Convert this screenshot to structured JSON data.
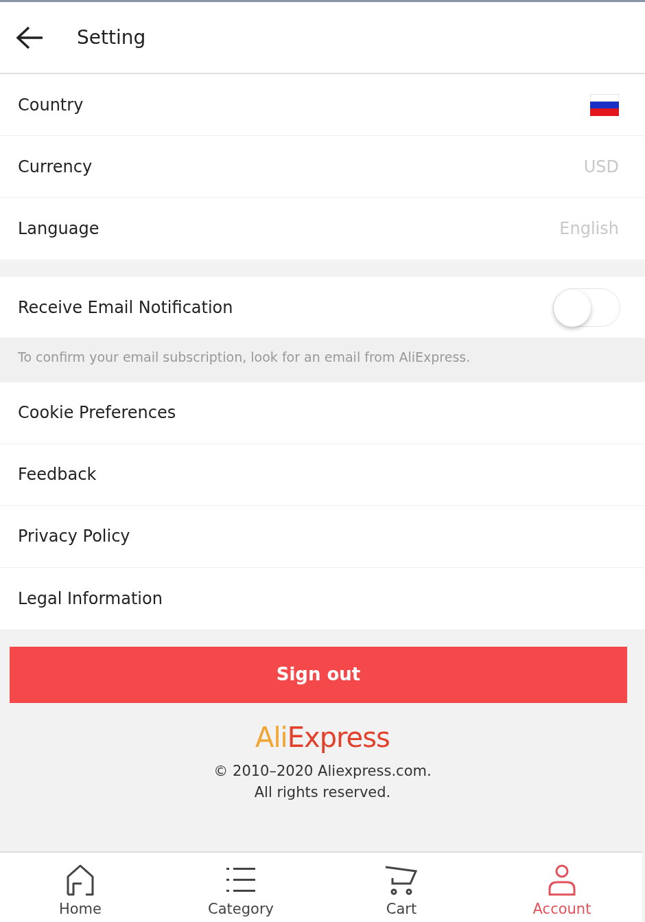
{
  "header": {
    "title": "Setting"
  },
  "sections": [
    {
      "rows": [
        {
          "kind": "flag",
          "label": "Country"
        },
        {
          "kind": "value",
          "label": "Currency",
          "value": "USD"
        },
        {
          "kind": "value",
          "label": "Language",
          "value": "English"
        }
      ]
    },
    {
      "rows": [
        {
          "kind": "toggle",
          "label": "Receive Email Notification",
          "on": false
        }
      ],
      "note": "To confirm your email subscription, look for an email from AliExpress."
    },
    {
      "rows": [
        {
          "kind": "link",
          "label": "Cookie Preferences"
        },
        {
          "kind": "link",
          "label": "Feedback"
        },
        {
          "kind": "link",
          "label": "Privacy Policy"
        },
        {
          "kind": "link",
          "label": "Legal Information"
        }
      ]
    }
  ],
  "sign_out": "Sign out",
  "logo": {
    "part_1": "Ali",
    "part_2": "Express"
  },
  "copyright": [
    "© 2010–2020 Aliexpress.com.",
    "All rights reserved."
  ],
  "nav": [
    {
      "label": "Home",
      "selected": false
    },
    {
      "label": "Category",
      "selected": false
    },
    {
      "label": "Cart",
      "selected": false
    },
    {
      "label": "Account",
      "selected": true
    }
  ]
}
